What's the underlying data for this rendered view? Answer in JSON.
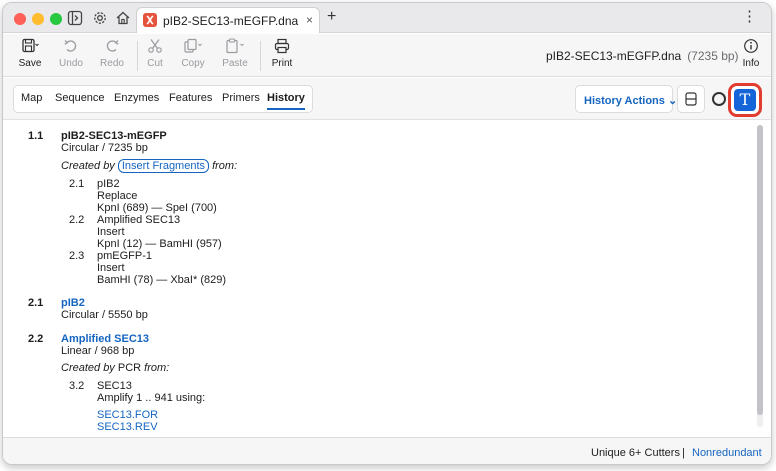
{
  "tabbar": {
    "tab_title": "pIB2-SEC13-mEGFP.dna",
    "close_glyph": "×",
    "new_tab_glyph": "+",
    "more_glyph": "⋮"
  },
  "toolbar": {
    "save": "Save",
    "undo": "Undo",
    "redo": "Redo",
    "cut": "Cut",
    "copy": "Copy",
    "paste": "Paste",
    "print": "Print",
    "info": "Info",
    "doc_name": "pIB2-SEC13-mEGFP.dna",
    "doc_length": "(7235 bp)"
  },
  "view_tabs": [
    "Map",
    "Sequence",
    "Enzymes",
    "Features",
    "Primers",
    "History"
  ],
  "active_tab": "History",
  "history_actions": "History Actions ⌄",
  "history": {
    "root": {
      "num": "1.1",
      "name": "pIB2-SEC13-mEGFP",
      "desc": "Circular / 7235 bp",
      "created_prefix": "Created by",
      "created_op": "Insert Fragments",
      "created_suffix": "from:"
    },
    "children": [
      {
        "num": "2.1",
        "name": "pIB2",
        "role": "Replace",
        "sites": "KpnI (689) — SpeI (700)"
      },
      {
        "num": "2.2",
        "name": "Amplified SEC13",
        "role": "Insert",
        "sites": "KpnI (12) — BamHI (957)"
      },
      {
        "num": "2.3",
        "name": "pmEGFP-1",
        "role": "Insert",
        "sites": "BamHI (78) — XbaI* (829)"
      }
    ],
    "node_21": {
      "num": "2.1",
      "name": "pIB2",
      "desc": "Circular / 5550 bp"
    },
    "node_22": {
      "num": "2.2",
      "name": "Amplified SEC13",
      "desc": "Linear / 968 bp",
      "created_prefix": "Created by",
      "created_op": "PCR",
      "created_suffix": "from:",
      "child_num": "3.2",
      "child_name": "SEC13",
      "child_detail": "Amplify 1 .. 941 using:",
      "primers": [
        "SEC13.FOR",
        "SEC13.REV"
      ]
    }
  },
  "statusbar": {
    "cutters": "Unique 6+ Cutters",
    "separator": "|",
    "mode": "Nonredundant"
  },
  "colors": {
    "accent": "#1565c0",
    "highlight": "#e23b2f",
    "app_icon": "#e4533d"
  }
}
